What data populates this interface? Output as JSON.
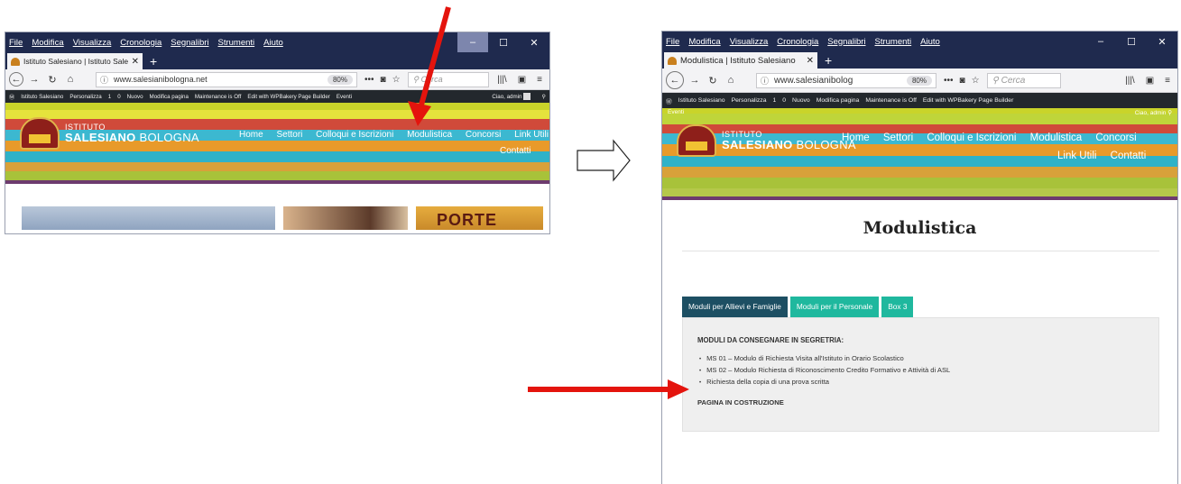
{
  "colors": {
    "menubar": "#1f2a4e",
    "wp_adminbar": "#23282d",
    "arrow_red": "#e4140d",
    "tab_active": "#1d4f63",
    "tab_inactive": "#1fb89e"
  },
  "left_window": {
    "menu": [
      "File",
      "Modifica",
      "Visualizza",
      "Cronologia",
      "Segnalibri",
      "Strumenti",
      "Aiuto"
    ],
    "tab_title": "Istituto Salesiano | Istituto Sale",
    "url": "www.salesianibologna.net",
    "zoom": "80%",
    "search_placeholder": "Cerca",
    "wp_bar": [
      "Istituto Salesiano",
      "Personalizza",
      "1",
      "0",
      "Nuovo",
      "Modifica pagina",
      "Maintenance is Off",
      "Edit with WPBakery Page Builder",
      "Eventi"
    ],
    "wp_greeting": "Ciao, admin",
    "logo_line1": "ISTITUTO",
    "logo_line2a": "SALESIANO",
    "logo_line2b": "BOLOGNA",
    "nav": [
      "Home",
      "Settori",
      "Colloqui e Iscrizioni",
      "Modulistica",
      "Concorsi",
      "Link Utili"
    ],
    "nav_row2": "Contatti",
    "banner_text": "PORTE"
  },
  "right_window": {
    "menu": [
      "File",
      "Modifica",
      "Visualizza",
      "Cronologia",
      "Segnalibri",
      "Strumenti",
      "Aiuto"
    ],
    "tab_title": "Modulistica | Istituto Salesiano",
    "url": "www.salesianibolog",
    "zoom": "80%",
    "search_placeholder": "Cerca",
    "wp_bar": [
      "Istituto Salesiano",
      "Personalizza",
      "1",
      "0",
      "Nuovo",
      "Modifica pagina",
      "Maintenance is Off",
      "Edit with WPBakery Page Builder"
    ],
    "wp_events": "Eventi",
    "wp_greeting": "Ciao, admin",
    "logo_line1": "ISTITUTO",
    "logo_line2a": "SALESIANO",
    "logo_line2b": "BOLOGNA",
    "nav": [
      "Home",
      "Settori",
      "Colloqui e Iscrizioni",
      "Modulistica",
      "Concorsi"
    ],
    "nav_row2": [
      "Link Utili",
      "Contatti"
    ],
    "page_title": "Modulistica",
    "tabs": [
      "Moduli per Allievi e Famiglie",
      "Moduli per il Personale",
      "Box 3"
    ],
    "panel_heading": "MODULI DA CONSEGNARE IN SEGRETRIA:",
    "panel_items": [
      "MS 01 – Modulo di Richiesta Visita all'Istituto in Orario Scolastico",
      "MS 02 – Modulo Richiesta di Riconoscimento Credito Formativo e Attività di ASL",
      "Richiesta della copia di una prova scritta"
    ],
    "panel_footer": "PAGINA IN COSTRUZIONE"
  }
}
